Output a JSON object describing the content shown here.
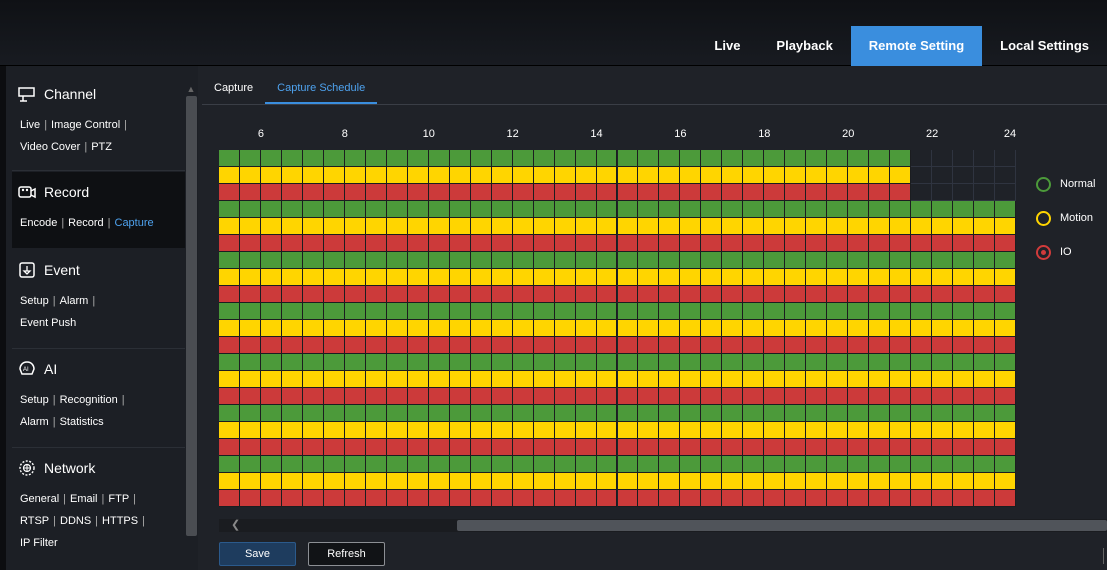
{
  "top_nav": {
    "items": [
      {
        "label": "Live"
      },
      {
        "label": "Playback"
      },
      {
        "label": "Remote Setting",
        "active": true
      },
      {
        "label": "Local Settings"
      }
    ],
    "active_color": "#3a8ede"
  },
  "sidebar": {
    "sections": [
      {
        "title": "Channel",
        "icon": "channel-icon",
        "links": [
          [
            "Live",
            "Image Control"
          ],
          [
            "Video Cover",
            "PTZ"
          ]
        ]
      },
      {
        "title": "Record",
        "icon": "record-icon",
        "active": true,
        "links": [
          [
            "Encode",
            "Record",
            "Capture"
          ]
        ],
        "active_link": "Capture"
      },
      {
        "title": "Event",
        "icon": "event-icon",
        "links": [
          [
            "Setup",
            "Alarm"
          ],
          [
            "Event Push"
          ]
        ]
      },
      {
        "title": "AI",
        "icon": "ai-icon",
        "links": [
          [
            "Setup",
            "Recognition"
          ],
          [
            "Alarm",
            "Statistics"
          ]
        ]
      },
      {
        "title": "Network",
        "icon": "network-icon",
        "links": [
          [
            "General",
            "Email",
            "FTP"
          ],
          [
            "RTSP",
            "DDNS",
            "HTTPS"
          ],
          [
            "IP Filter"
          ]
        ]
      }
    ]
  },
  "tabs": [
    {
      "label": "Capture"
    },
    {
      "label": "Capture Schedule",
      "active": true
    }
  ],
  "schedule": {
    "hour_labels": [
      "6",
      "8",
      "10",
      "12",
      "14",
      "16",
      "18",
      "20",
      "22",
      "24"
    ],
    "visible_hours_start": 5,
    "visible_hours_end": 24,
    "columns_per_hour": 2,
    "days": 7,
    "rows_per_day": [
      "normal",
      "motion",
      "io"
    ],
    "first_day_filled_until_hour": 21.5,
    "colors": {
      "normal": "#4c9a3a",
      "motion": "#ffd500",
      "io": "#cc3a3a"
    }
  },
  "legend": [
    {
      "label": "Normal",
      "color": "#4c9a3a",
      "icon": "normal-ring-icon"
    },
    {
      "label": "Motion",
      "color": "#ffd500",
      "icon": "motion-ring-icon"
    },
    {
      "label": "IO",
      "color": "#d13b3b",
      "icon": "io-ring-icon",
      "selected": true
    }
  ],
  "buttons": {
    "save": "Save",
    "refresh": "Refresh"
  },
  "separator": "|"
}
